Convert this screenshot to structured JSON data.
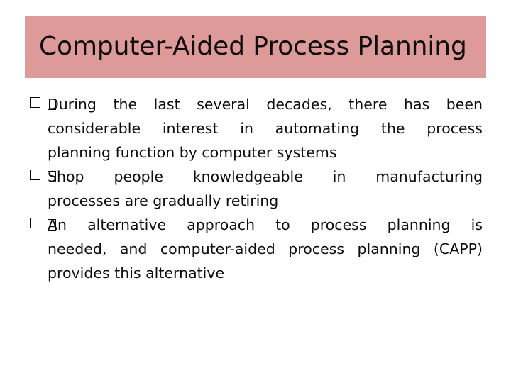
{
  "slide": {
    "title": "Computer-Aided Process Planning",
    "title_band_color": "#dd9a99",
    "text_color": "#0d0d0d",
    "background_color": "#ffffff"
  },
  "body": {
    "bullet_glyph": "missing-glyph-box",
    "bullets": [
      {
        "id": "bullet-1",
        "text": "During the last several decades, there has been considerable interest in automating the process planning function by computer systems",
        "lines": [
          "During the last several decades, there has been",
          "considerable interest in automating the process",
          "planning function by computer systems"
        ]
      },
      {
        "id": "bullet-2",
        "text": "Shop people knowledgeable in manufacturing processes are gradually retiring",
        "lines": [
          "Shop people knowledgeable in manufacturing",
          "processes are gradually retiring"
        ]
      },
      {
        "id": "bullet-3",
        "text": "An alternative approach to process planning is needed, and computer-aided process planning (CAPP) provides this alternative",
        "lines": [
          "An alternative approach to process planning is",
          "needed, and computer-aided process planning (CAPP)",
          "provides this alternative"
        ]
      }
    ]
  }
}
